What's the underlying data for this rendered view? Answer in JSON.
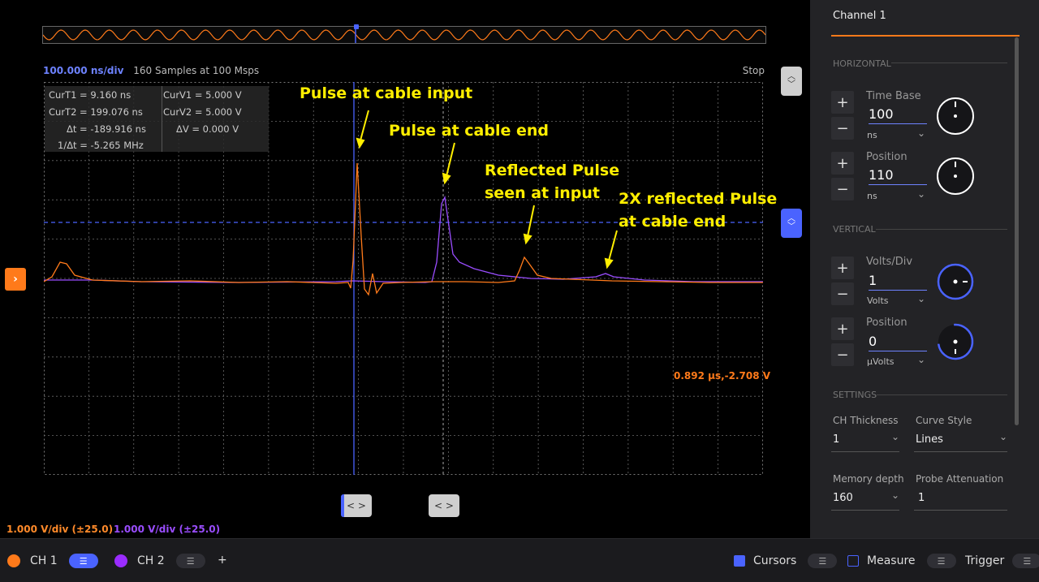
{
  "top": {
    "time_div": "100.000 ns/div",
    "samples": "160  Samples at 100 Msps",
    "run_state": "Stop"
  },
  "cursor_readout": {
    "curt1": "CurT1 = 9.160 ns",
    "curt2": "CurT2 = 199.076 ns",
    "dt": "Δt = -189.916 ns",
    "inv_dt": "1/Δt = -5.265 MHz",
    "curv1": "CurV1 = 5.000 V",
    "curv2": "CurV2 = 5.000 V",
    "dv": "ΔV =  0.000 V"
  },
  "annotations": {
    "a1": "Pulse at cable input",
    "a2": "Pulse at cable end",
    "a3_l1": "Reflected Pulse",
    "a3_l2": "seen at input",
    "a4_l1": "2X reflected Pulse",
    "a4_l2": "at cable end"
  },
  "value_readout": "0.892 μs,-2.708 V",
  "scales": {
    "ch1": "1.000 V/div (±25.0)",
    "ch2": "1.000 V/div (±25.0)"
  },
  "handles": {
    "h1": "< >",
    "h2": "< >"
  },
  "colors": {
    "ch1": "#ff7a1a",
    "ch2": "#9a4dff",
    "accent": "#4a63ff",
    "annotation": "#ffee00"
  },
  "bottom": {
    "ch1": "CH 1",
    "ch2": "CH 2",
    "add": "+",
    "cursors": "Cursors",
    "measure": "Measure",
    "trigger": "Trigger"
  },
  "panel": {
    "title": "Channel 1",
    "horizontal": "HORIZONTAL",
    "vertical": "VERTICAL",
    "settings": "SETTINGS",
    "plus": "+",
    "minus": "−",
    "time_base": {
      "label": "Time Base",
      "value": "100",
      "unit": "ns"
    },
    "h_position": {
      "label": "Position",
      "value": "110",
      "unit": "ns"
    },
    "volts_div": {
      "label": "Volts/Div",
      "value": "1",
      "unit": "Volts"
    },
    "v_position": {
      "label": "Position",
      "value": "0",
      "unit": "μVolts"
    },
    "ch_thickness": {
      "label": "CH Thickness",
      "value": "1"
    },
    "curve_style": {
      "label": "Curve Style",
      "value": "Lines"
    },
    "memory_depth": {
      "label": "Memory depth",
      "value": "160"
    },
    "probe_att": {
      "label": "Probe Attenuation",
      "value": "1"
    }
  }
}
